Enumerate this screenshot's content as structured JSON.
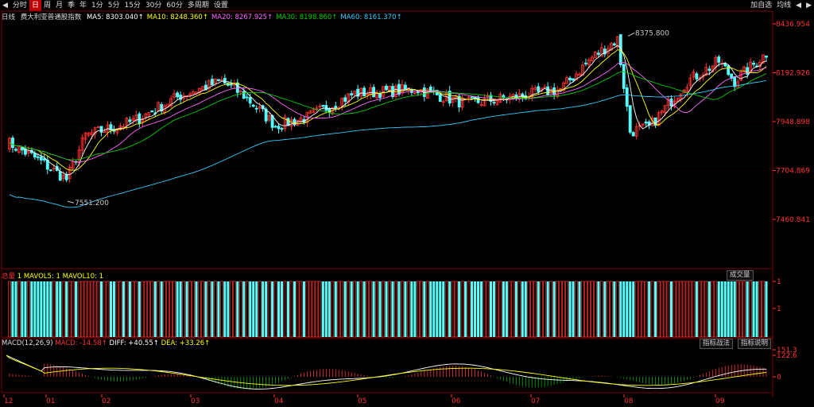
{
  "toolbar": {
    "nav_left": "◀",
    "items": [
      "分时",
      "日",
      "周",
      "月",
      "季",
      "年",
      "1分",
      "5分",
      "15分",
      "30分",
      "60分",
      "多周期",
      "设置"
    ],
    "active_index": 1,
    "right": {
      "add_watch": "加自选",
      "period_toggle": "均线",
      "prev": "◀",
      "next": "▶"
    }
  },
  "price_panel": {
    "period_label": "日线",
    "index_name": "费大利亚普通股指数",
    "ma": [
      {
        "label": "MA5: 8303.040↑",
        "color": "#ffffff"
      },
      {
        "label": "MA10: 8248.360↑",
        "color": "#ffff00"
      },
      {
        "label": "MA20: 8267.925↑",
        "color": "#ff66ff"
      },
      {
        "label": "MA30: 8198.860↑",
        "color": "#00cc00"
      },
      {
        "label": "MA60: 8161.370↑",
        "color": "#33ccff"
      }
    ],
    "y_ticks": [
      "8436.954",
      "8192.926",
      "7948.898",
      "7704.869",
      "7460.841"
    ],
    "y_tick_values": [
      8436.954,
      8192.926,
      7948.898,
      7704.869,
      7460.841
    ],
    "max_label": "8375.800",
    "min_label": "7551.200"
  },
  "volume_panel": {
    "label_vol": "总量",
    "label_mavol": "1 MAVOL5: 1 MAVOL10: 1",
    "tag": "成交量",
    "y_ticks": [
      "1",
      "1"
    ]
  },
  "macd_panel": {
    "label_macd": "MACD(12,26,9)",
    "macd": "MACD: -14.58↑",
    "diff": "DIFF: +40.55↑",
    "dea": "DEA: +33.26↑",
    "tag_left": "指标战法",
    "tag_right": "指标说明",
    "y_ticks": [
      "151.3",
      "122.6",
      "0"
    ]
  },
  "x_axis": [
    "12",
    "01",
    "02",
    "03",
    "04",
    "05",
    "06",
    "07",
    "08",
    "09"
  ],
  "colors": {
    "up": "#ff3232",
    "down": "#54ffff",
    "grid": "#7a0000",
    "axis_text": "#ff3232"
  }
}
